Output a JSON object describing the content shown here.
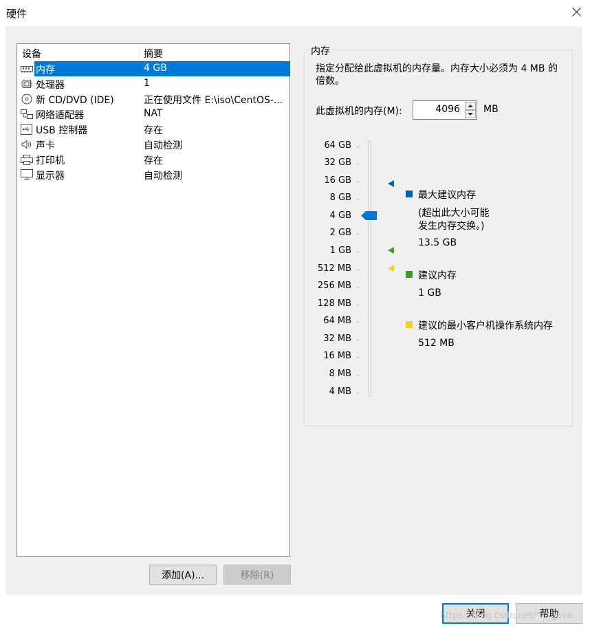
{
  "window": {
    "title": "硬件"
  },
  "device_list": {
    "columns": [
      "设备",
      "摘要"
    ],
    "rows": [
      {
        "name": "内存",
        "summary": "4 GB",
        "icon": "memory-icon"
      },
      {
        "name": "处理器",
        "summary": "1",
        "icon": "cpu-icon"
      },
      {
        "name": "新 CD/DVD (IDE)",
        "summary": "正在使用文件 E:\\iso\\CentOS-...",
        "icon": "cd-dvd-icon"
      },
      {
        "name": "网络适配器",
        "summary": "NAT",
        "icon": "network-adapter-icon"
      },
      {
        "name": "USB 控制器",
        "summary": "存在",
        "icon": "usb-icon"
      },
      {
        "name": "声卡",
        "summary": "自动检测",
        "icon": "speaker-icon"
      },
      {
        "name": "打印机",
        "summary": "存在",
        "icon": "printer-icon"
      },
      {
        "name": "显示器",
        "summary": "自动检测",
        "icon": "monitor-icon"
      }
    ],
    "selected_index": 0
  },
  "buttons": {
    "add": "添加(A)...",
    "remove": "移除(R)",
    "close": "关闭",
    "help": "帮助"
  },
  "memory": {
    "group_title": "内存",
    "description": "指定分配给此虚拟机的内存量。内存大小必须为 4 MB 的倍数。",
    "field_label": "此虚拟机的内存(M):",
    "value": "4096",
    "unit": "MB",
    "scale": [
      "64 GB",
      "32 GB",
      "16 GB",
      "8 GB",
      "4 GB",
      "2 GB",
      "1 GB",
      "512 MB",
      "256 MB",
      "128 MB",
      "64 MB",
      "32 MB",
      "16 MB",
      "8 MB",
      "4 MB"
    ],
    "current_level": "4 GB",
    "legend": {
      "max": {
        "label": "最大建议内存",
        "note_line1": "(超出此大小可能",
        "note_line2": "发生内存交换。)",
        "value": "13.5 GB",
        "color": "#0064b0"
      },
      "recommended": {
        "label": "建议内存",
        "value": "1 GB",
        "color": "#3f9b27"
      },
      "min": {
        "label": "建议的最小客户机操作系统内存",
        "value": "512 MB",
        "color": "#f3d21c"
      }
    }
  },
  "watermark": "https://blog.csdn.net/***_java"
}
